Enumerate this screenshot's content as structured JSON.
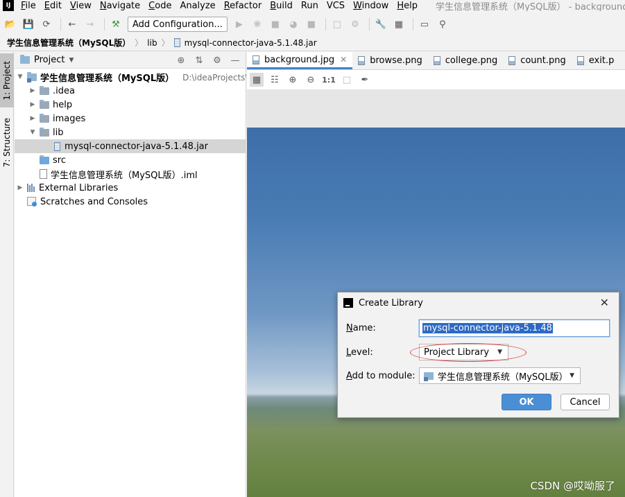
{
  "menu": {
    "app_logo": "IJ",
    "items": [
      {
        "key": "F",
        "rest": "ile"
      },
      {
        "key": "E",
        "rest": "dit"
      },
      {
        "key": "V",
        "rest": "iew"
      },
      {
        "key": "N",
        "rest": "avigate"
      },
      {
        "key": "C",
        "rest": "ode"
      },
      {
        "key": "",
        "rest": "Analyze"
      },
      {
        "key": "R",
        "rest": "efactor"
      },
      {
        "key": "B",
        "rest": "uild"
      },
      {
        "key": "",
        "rest": "Run"
      },
      {
        "key": "",
        "rest": "VCS"
      },
      {
        "key": "W",
        "rest": "indow"
      },
      {
        "key": "H",
        "rest": "elp"
      }
    ],
    "window_title": "学生信息管理系统（MySQL版） - background.jpg - Inte"
  },
  "toolbar": {
    "add_config_label": "Add Configuration..."
  },
  "breadcrumb": {
    "project": "学生信息管理系统（MySQL版）",
    "folder": "lib",
    "file": "mysql-connector-java-5.1.48.jar"
  },
  "stripe": {
    "project_tab": "1: Project",
    "structure_tab": "7: Structure"
  },
  "project_panel": {
    "title": "Project",
    "tree": {
      "root_name": "学生信息管理系统（MySQL版）",
      "root_path": "D:\\ideaProjects\\学生",
      "idea": ".idea",
      "help": "help",
      "images": "images",
      "lib": "lib",
      "jar": "mysql-connector-java-5.1.48.jar",
      "src": "src",
      "iml": "学生信息管理系统（MySQL版）.iml",
      "external": "External Libraries",
      "scratches": "Scratches and Consoles"
    }
  },
  "editor": {
    "tabs": [
      "background.jpg",
      "browse.png",
      "college.png",
      "count.png",
      "exit.p"
    ],
    "zoom_actual": "1:1",
    "watermark": "CSDN @哎呦服了"
  },
  "dialog": {
    "title": "Create Library",
    "name_label_key": "N",
    "name_label_rest": "ame:",
    "name_value": "mysql-connector-java-5.1.48",
    "level_label_key": "L",
    "level_label_rest": "evel:",
    "level_value": "Project Library",
    "module_label_key": "A",
    "module_label_rest": "dd to module:",
    "module_value": "学生信息管理系统（MySQL版）",
    "ok": "OK",
    "cancel": "Cancel"
  }
}
